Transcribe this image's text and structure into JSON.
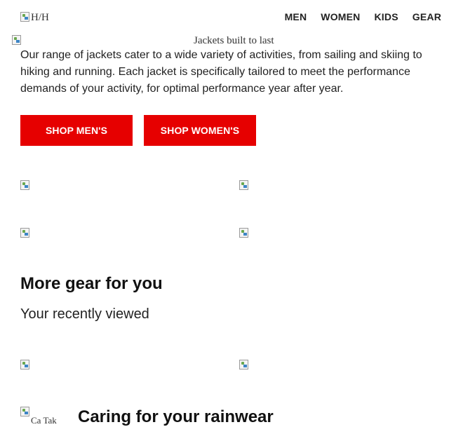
{
  "header": {
    "logo_alt": "H/H",
    "nav": [
      "MEN",
      "WOMEN",
      "KIDS",
      "GEAR"
    ]
  },
  "hero": {
    "caption": "Jackets built to last"
  },
  "intro": {
    "text": "Our range of jackets cater to a wide variety of activities, from sailing and skiing to hiking and running. Each jacket is specifically tailored to meet the performance demands of your activity, for optimal performance year after year."
  },
  "buttons": {
    "shop_mens": "SHOP MEN'S",
    "shop_womens": "SHOP WOMEN'S"
  },
  "more_gear": {
    "title": "More gear for you",
    "subtitle": "Your recently viewed"
  },
  "care": {
    "title": "Caring for your rainwear",
    "image_alt": "Ca Tak"
  },
  "colors": {
    "accent": "#e60000",
    "text": "#111111"
  }
}
